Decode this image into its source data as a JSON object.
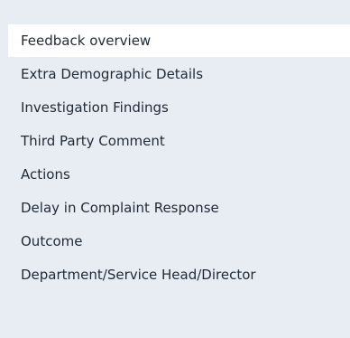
{
  "nav": {
    "items": [
      {
        "label": "Feedback overview",
        "active": true
      },
      {
        "label": "Extra Demographic Details",
        "active": false
      },
      {
        "label": "Investigation Findings",
        "active": false
      },
      {
        "label": "Third Party Comment",
        "active": false
      },
      {
        "label": "Actions",
        "active": false
      },
      {
        "label": "Delay in Complaint Response",
        "active": false
      },
      {
        "label": "Outcome",
        "active": false
      },
      {
        "label": "Department/Service Head/Director",
        "active": false
      }
    ]
  }
}
